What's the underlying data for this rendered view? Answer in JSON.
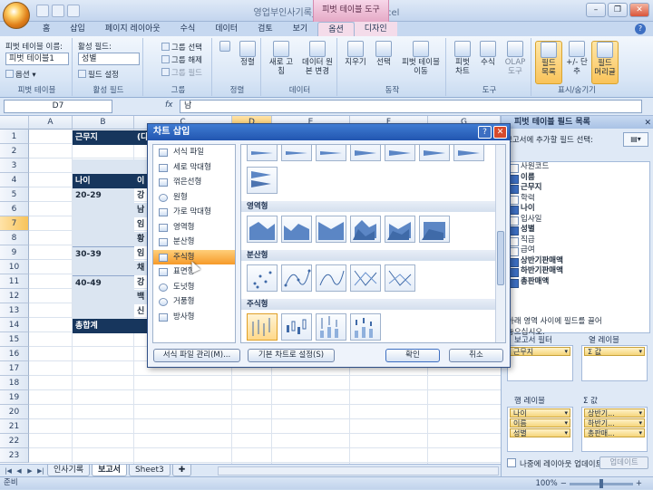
{
  "window": {
    "title": "영업부인사기록_1 - Microsoft Excel",
    "context_tool": "피벗 테이블 도구"
  },
  "ribbon_tabs": [
    "홈",
    "삽입",
    "페이지 레이아웃",
    "수식",
    "데이터",
    "검토",
    "보기",
    "옵션",
    "디자인"
  ],
  "ribbon": {
    "pivot_table_name_label": "피벗 테이블 이름:",
    "pivot_table_name_value": "피벗 테이블1",
    "options_label": "옵션",
    "active_field_label": "활성 필드:",
    "active_field_value": "성별",
    "field_settings_label": "필드 설정",
    "group_selection": "그룹 선택",
    "ungroup": "그룹 해제",
    "group_field": "그룹 필드",
    "sort_label": "정렬",
    "refresh_label": "새로 고침",
    "change_source_label": "데이터 원본 변경",
    "clear_label": "지우기",
    "select_label": "선택",
    "move_label": "피벗 테이블 이동",
    "pivot_chart_label": "피벗 차트",
    "formula_label": "수식",
    "olap_label": "OLAP 도구",
    "field_list_label": "필드 목록",
    "buttons_label": "+/- 단추",
    "field_headers_label": "필드 머리글",
    "groups": [
      "피벗 테이블",
      "활성 필드",
      "그룹",
      "정렬",
      "데이터",
      "동작",
      "도구",
      "표시/숨기기"
    ]
  },
  "formula_bar": {
    "name_box": "D7",
    "fx": "fx",
    "value": "남"
  },
  "sheet": {
    "columns": [
      "A",
      "B",
      "C",
      "D",
      "E",
      "F",
      "G",
      "H"
    ],
    "rows": [
      "1",
      "2",
      "3",
      "4",
      "5",
      "6",
      "7",
      "8",
      "9",
      "10",
      "11",
      "12",
      "13",
      "14",
      "15",
      "16",
      "17",
      "18",
      "19",
      "20",
      "21",
      "22",
      "23"
    ],
    "cells": {
      "b1": "근무지",
      "b1_suffix": "(다",
      "b4": "나이",
      "c4": "이",
      "b5": "20-29",
      "c5": "강",
      "c6": "남",
      "c7": "임",
      "c8": "황",
      "b9": "30-39",
      "c9": "임",
      "c10": "채",
      "b11": "40-49",
      "c11": "강",
      "c12": "백",
      "c13": "신",
      "b14": "총합계"
    },
    "tabs": [
      "인사기록",
      "보고서",
      "Sheet3"
    ]
  },
  "status": {
    "ready": "준비",
    "zoom": "100%"
  },
  "field_pane": {
    "title": "피벗 테이블 필드 목록",
    "prompt": "보고서에 추가할 필드 선택:",
    "fields": [
      {
        "label": "사원코드",
        "checked": false,
        "bold": false
      },
      {
        "label": "이름",
        "checked": true,
        "bold": true
      },
      {
        "label": "근무지",
        "checked": true,
        "bold": true
      },
      {
        "label": "학력",
        "checked": false,
        "bold": false
      },
      {
        "label": "나이",
        "checked": true,
        "bold": true
      },
      {
        "label": "입사일",
        "checked": false,
        "bold": false
      },
      {
        "label": "성별",
        "checked": true,
        "bold": true
      },
      {
        "label": "직급",
        "checked": false,
        "bold": false
      },
      {
        "label": "급여",
        "checked": false,
        "bold": false
      },
      {
        "label": "상반기판매액",
        "checked": true,
        "bold": true
      },
      {
        "label": "하반기판매액",
        "checked": true,
        "bold": true
      },
      {
        "label": "총판매액",
        "checked": true,
        "bold": true
      }
    ],
    "drag_hint_1": "아래 영역 사이에 필드를 끌어",
    "drag_hint_2": "놓으십시오.",
    "report_filter_label": "보고서 필터",
    "column_labels_label": "열 레이블",
    "row_labels_label": "행 레이블",
    "values_label": "Σ 값",
    "values_zone_label": "값",
    "report_filter_items": [
      "근무지"
    ],
    "column_items": [
      "Σ 값"
    ],
    "row_items": [
      "나이",
      "이름",
      "성별"
    ],
    "value_items": [
      "상반기...",
      "하반기...",
      "총판매..."
    ],
    "defer_label": "나중에 레이아웃 업데이트",
    "update_button": "업데이트"
  },
  "dialog": {
    "title": "차트 삽입",
    "categories": [
      {
        "label": "서식 파일",
        "icon": "folder-icon"
      },
      {
        "label": "세로 막대형",
        "icon": "column-chart-icon"
      },
      {
        "label": "꺾은선형",
        "icon": "line-chart-icon"
      },
      {
        "label": "원형",
        "icon": "pie-chart-icon"
      },
      {
        "label": "가로 막대형",
        "icon": "bar-chart-icon"
      },
      {
        "label": "영역형",
        "icon": "area-chart-icon"
      },
      {
        "label": "분산형",
        "icon": "scatter-chart-icon"
      },
      {
        "label": "주식형",
        "icon": "stock-chart-icon"
      },
      {
        "label": "표면형",
        "icon": "surface-chart-icon"
      },
      {
        "label": "도넛형",
        "icon": "doughnut-chart-icon"
      },
      {
        "label": "거품형",
        "icon": "bubble-chart-icon"
      },
      {
        "label": "방사형",
        "icon": "radar-chart-icon"
      }
    ],
    "selected_category": "주식형",
    "section_area": "영역형",
    "section_scatter": "분산형",
    "section_stock": "주식형",
    "manage_templates": "서식 파일 관리(M)...",
    "set_default": "기본 차트로 설정(S)",
    "ok": "확인",
    "cancel": "취소"
  }
}
